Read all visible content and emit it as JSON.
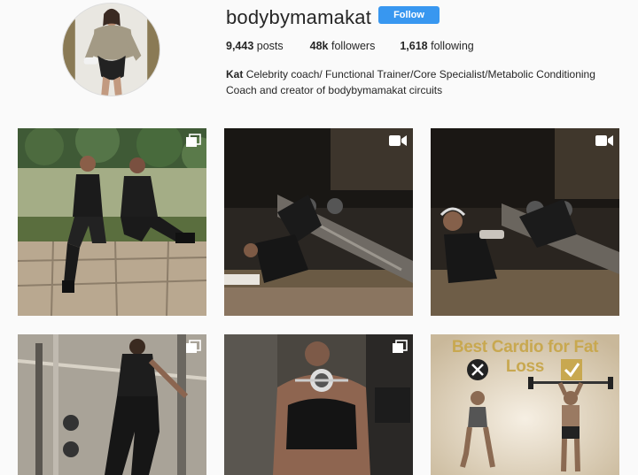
{
  "profile": {
    "username": "bodybymamakat",
    "follow_label": "Follow",
    "stats": {
      "posts_count": "9,443",
      "posts_label": "posts",
      "followers_count": "48k",
      "followers_label": "followers",
      "following_count": "1,618",
      "following_label": "following"
    },
    "bio_name": "Kat",
    "bio_text": "Celebrity coach/ Functional Trainer/Core Specialist/Metabolic Conditioning Coach and creator of bodybymamakat circuits"
  },
  "colors": {
    "follow_button": "#3897f0",
    "infographic_title": "#c8a850"
  },
  "posts": [
    {
      "type": "carousel",
      "icon": "multiple-photos-icon",
      "subject": "two women sitting on stone wall"
    },
    {
      "type": "video",
      "icon": "video-camera-icon",
      "subject": "woman on gym bench"
    },
    {
      "type": "video",
      "icon": "video-camera-icon",
      "subject": "woman on gym bench"
    },
    {
      "type": "carousel",
      "icon": "multiple-photos-icon",
      "subject": "woman at squat rack"
    },
    {
      "type": "carousel",
      "icon": "multiple-photos-icon",
      "subject": "woman with headphones"
    },
    {
      "type": "image",
      "subject": "infographic",
      "title": "Best Cardio for Fat Loss"
    }
  ]
}
